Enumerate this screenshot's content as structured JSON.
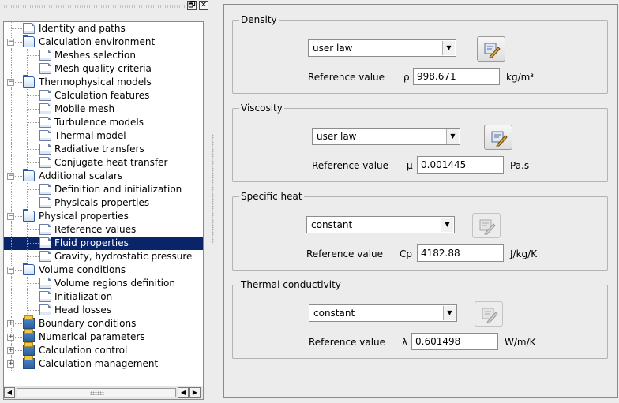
{
  "dock": {
    "float_button": "🗗",
    "close_button": "✕"
  },
  "tree": {
    "items": [
      {
        "label": "Identity and paths",
        "level": 0,
        "icon": "page-icon"
      },
      {
        "label": "Calculation environment",
        "level": 0,
        "icon": "folder-open-icon",
        "expander": "−"
      },
      {
        "label": "Meshes selection",
        "level": 1,
        "icon": "page-icon"
      },
      {
        "label": "Mesh quality criteria",
        "level": 1,
        "icon": "page-icon"
      },
      {
        "label": "Thermophysical models",
        "level": 0,
        "icon": "folder-open-icon",
        "expander": "−"
      },
      {
        "label": "Calculation features",
        "level": 1,
        "icon": "page-icon"
      },
      {
        "label": "Mobile mesh",
        "level": 1,
        "icon": "page-icon"
      },
      {
        "label": "Turbulence models",
        "level": 1,
        "icon": "page-icon"
      },
      {
        "label": "Thermal model",
        "level": 1,
        "icon": "page-icon"
      },
      {
        "label": "Radiative transfers",
        "level": 1,
        "icon": "page-icon"
      },
      {
        "label": "Conjugate heat transfer",
        "level": 1,
        "icon": "page-icon"
      },
      {
        "label": "Additional scalars",
        "level": 0,
        "icon": "folder-open-icon",
        "expander": "−"
      },
      {
        "label": "Definition and initialization",
        "level": 1,
        "icon": "page-icon"
      },
      {
        "label": "Physicals properties",
        "level": 1,
        "icon": "page-icon"
      },
      {
        "label": "Physical properties",
        "level": 0,
        "icon": "folder-open-icon",
        "expander": "−"
      },
      {
        "label": "Reference values",
        "level": 1,
        "icon": "page-icon"
      },
      {
        "label": "Fluid properties",
        "level": 1,
        "icon": "page-icon",
        "selected": true
      },
      {
        "label": "Gravity, hydrostatic pressure",
        "level": 1,
        "icon": "page-icon"
      },
      {
        "label": "Volume conditions",
        "level": 0,
        "icon": "folder-open-icon",
        "expander": "−"
      },
      {
        "label": "Volume regions definition",
        "level": 1,
        "icon": "page-icon"
      },
      {
        "label": "Initialization",
        "level": 1,
        "icon": "page-icon"
      },
      {
        "label": "Head losses",
        "level": 1,
        "icon": "page-icon"
      },
      {
        "label": "Boundary conditions",
        "level": 0,
        "icon": "folder-closed-icon",
        "expander": "+"
      },
      {
        "label": "Numerical parameters",
        "level": 0,
        "icon": "folder-closed-icon",
        "expander": "+"
      },
      {
        "label": "Calculation control",
        "level": 0,
        "icon": "folder-closed-icon",
        "expander": "+"
      },
      {
        "label": "Calculation management",
        "level": 0,
        "icon": "folder-closed-icon",
        "expander": "+"
      }
    ],
    "scroll_left": "◀",
    "scroll_right": "▶",
    "scroll_right_prev": "◀"
  },
  "properties": {
    "density": {
      "title": "Density",
      "law": "user law",
      "ref_label": "Reference value",
      "symbol": "ρ",
      "value": "998.671",
      "unit": "kg/m³",
      "edit_enabled": true
    },
    "viscosity": {
      "title": "Viscosity",
      "law": "user law",
      "ref_label": "Reference value",
      "symbol": "μ",
      "value": "0.001445",
      "unit": "Pa.s",
      "edit_enabled": true
    },
    "specific_heat": {
      "title": "Specific heat",
      "law": "constant",
      "ref_label": "Reference value",
      "symbol": "Cp",
      "value": "4182.88",
      "unit": "J/kg/K",
      "edit_enabled": false
    },
    "thermal_conductivity": {
      "title": "Thermal conductivity",
      "law": "constant",
      "ref_label": "Reference value",
      "symbol": "λ",
      "value": "0.601498",
      "unit": "W/m/K",
      "edit_enabled": false
    }
  },
  "colors": {
    "selection": "#0a246a",
    "folder_blue": "#2f5aa0"
  }
}
